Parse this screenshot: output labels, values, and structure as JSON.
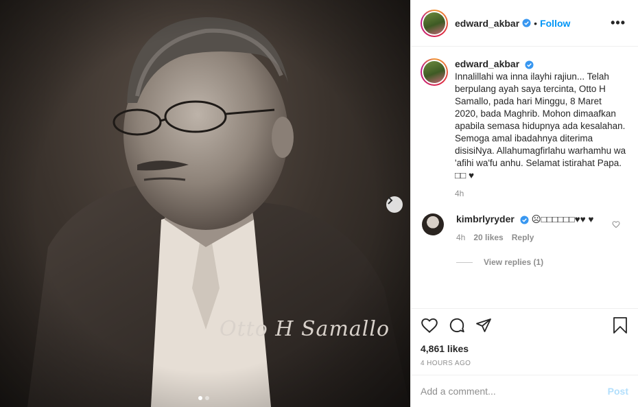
{
  "media": {
    "signature_text": "Otto H Samallo",
    "next_icon": "chevron-right-icon",
    "carousel": {
      "count": 2,
      "active": 0
    }
  },
  "header": {
    "username": "edward_akbar",
    "separator": "•",
    "follow_label": "Follow",
    "more_label": "•••"
  },
  "caption": {
    "username": "edward_akbar",
    "text": "Innalillahi wa inna ilayhi rajiun... Telah berpulang ayah saya tercinta, Otto H Samallo, pada hari Minggu, 8 Maret 2020, bada Maghrib. Mohon dimaafkan apabila semasa hidupnya ada kesalahan. Semoga amal ibadahnya diterima disisiNya. Allahumagfirlahu warhamhu wa 'afihi wa'fu anhu. Selamat istirahat Papa. □□ ♥",
    "time": "4h"
  },
  "comment": {
    "username": "kimbrlyryder",
    "text": "☹□□□□□□♥♥ ♥",
    "time": "4h",
    "likes": "20 likes",
    "reply_label": "Reply",
    "view_replies": "View replies (1)"
  },
  "actions": {
    "likes": "4,861 likes",
    "posted": "4 HOURS AGO"
  },
  "add_comment": {
    "placeholder": "Add a comment...",
    "post_label": "Post"
  },
  "colors": {
    "accent": "#0095f6",
    "post_disabled": "#b2dffc",
    "verified": "#3897f0",
    "muted": "#8e8e8e"
  }
}
